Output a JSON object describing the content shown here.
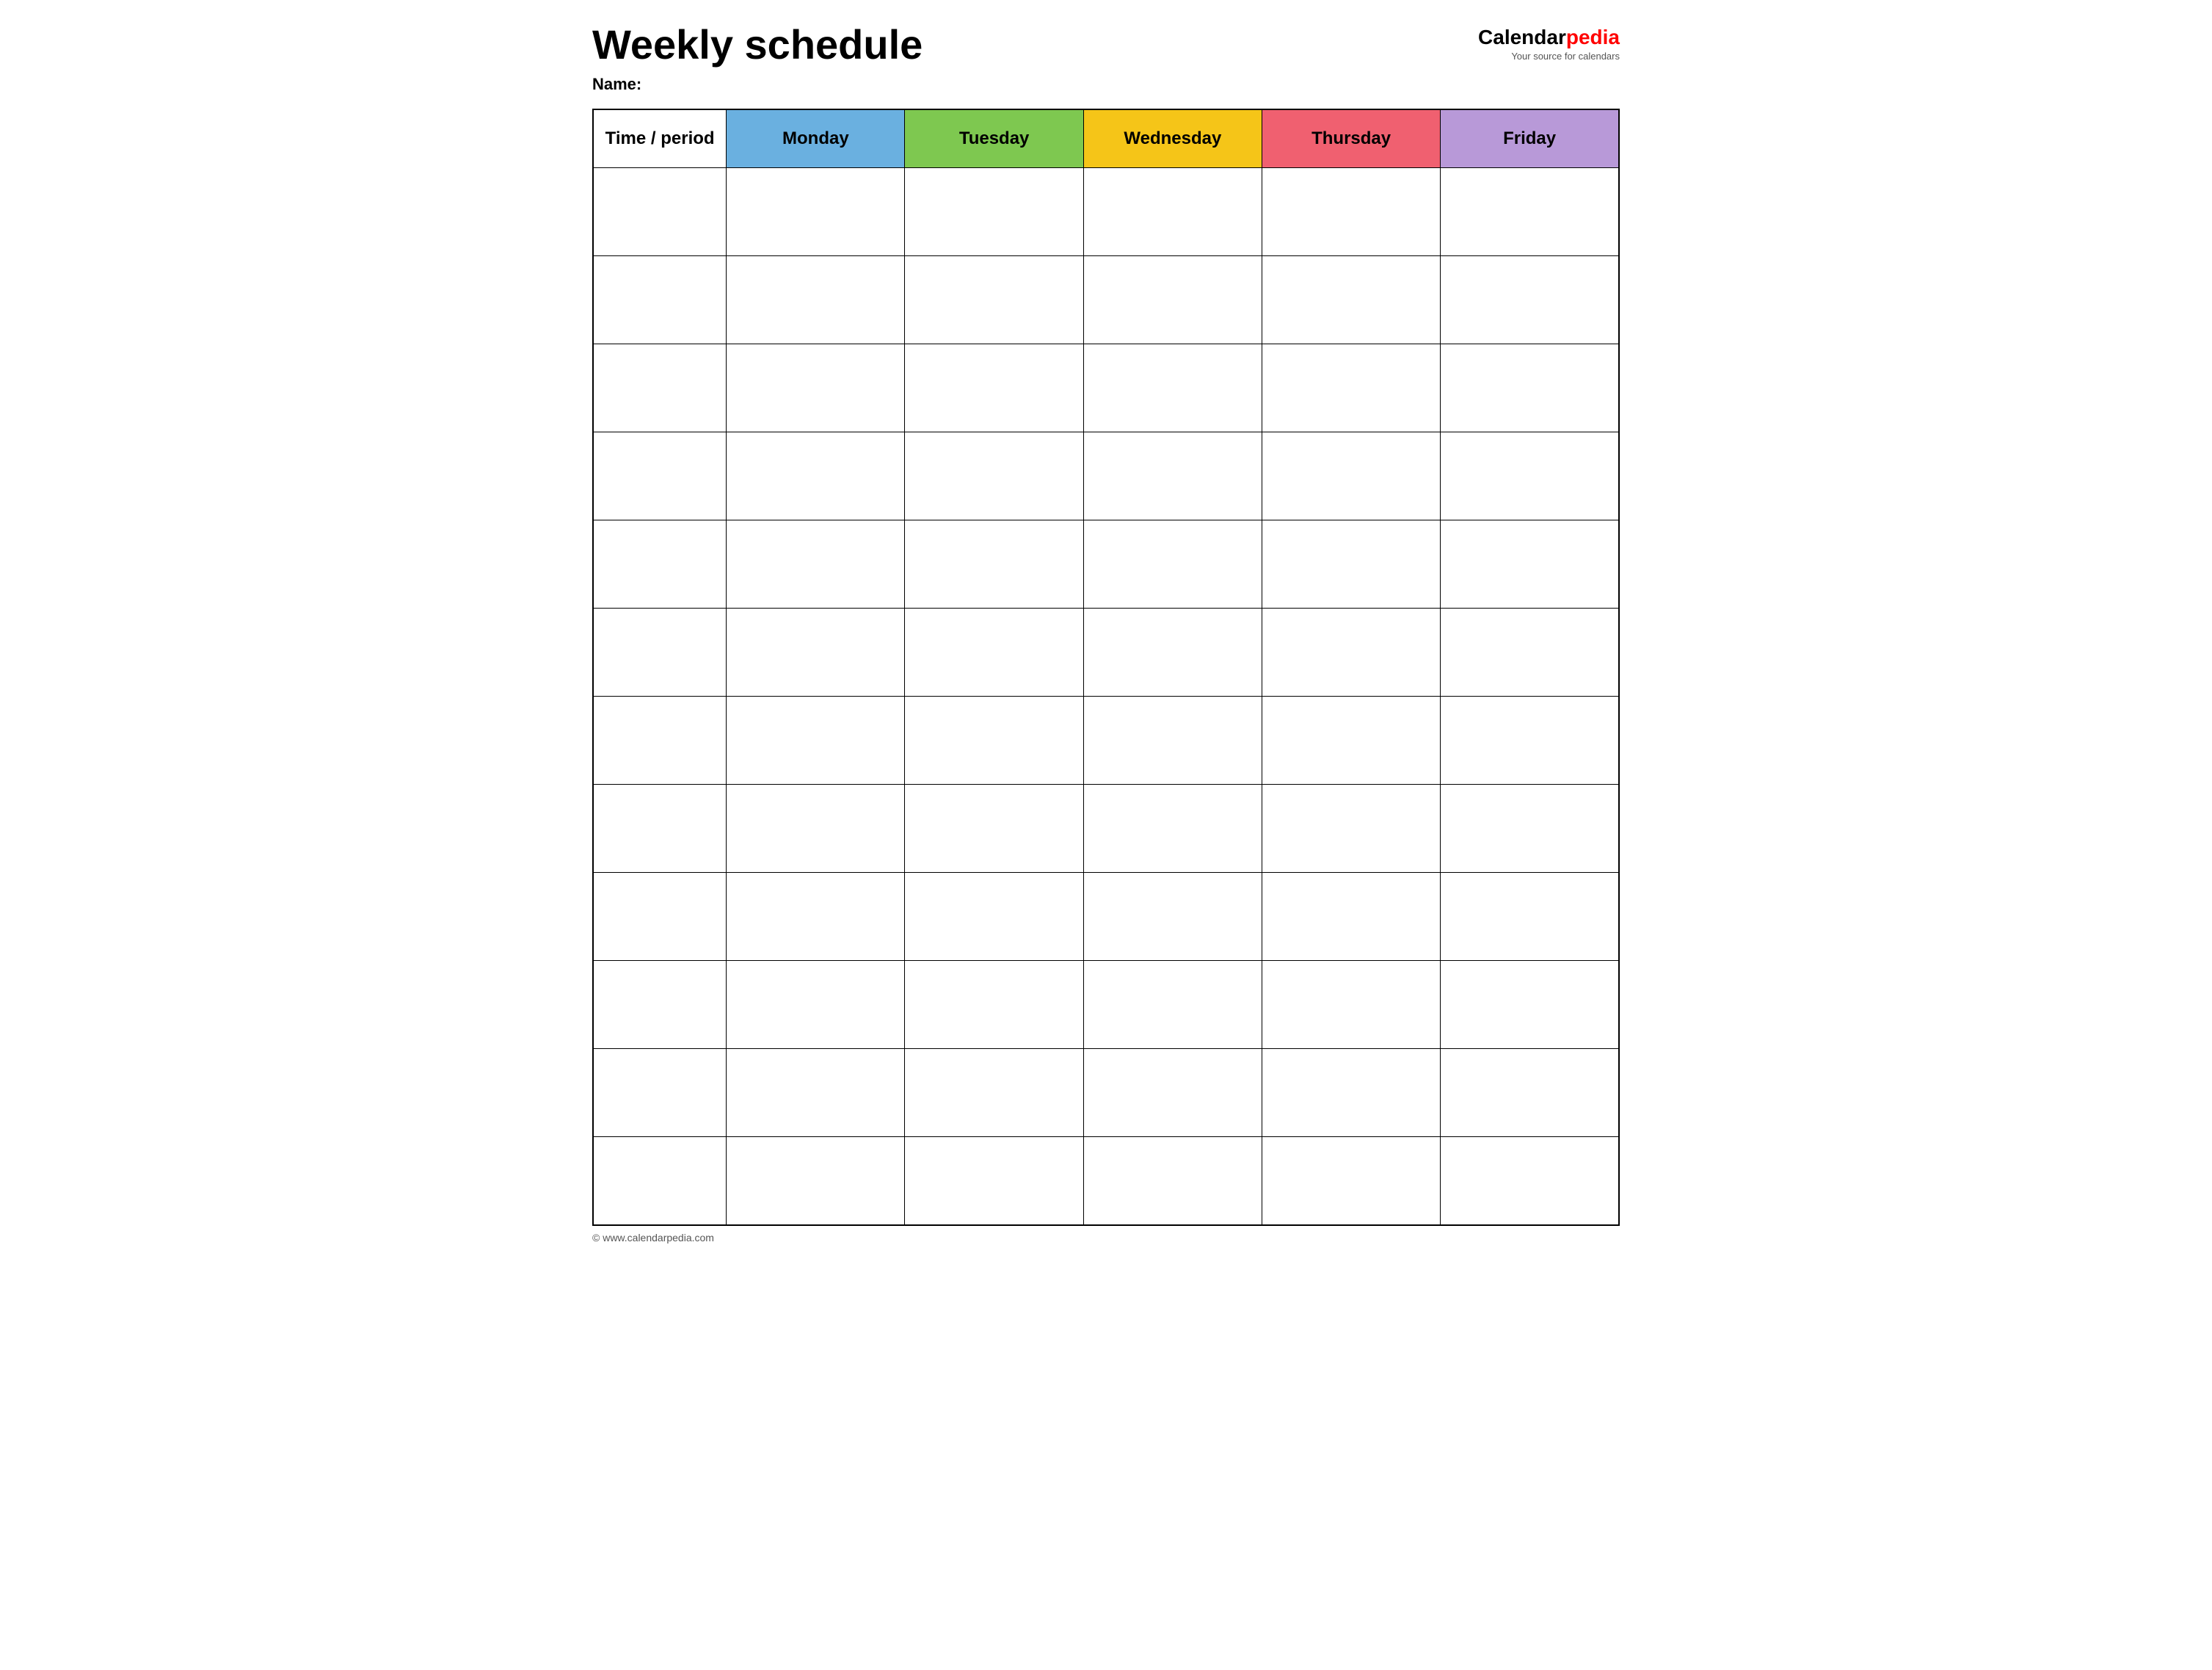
{
  "header": {
    "title": "Weekly schedule",
    "logo_calendar": "Calendar",
    "logo_pedia": "pedia",
    "logo_tagline": "Your source for calendars"
  },
  "name_label": "Name:",
  "columns": [
    {
      "id": "time",
      "label": "Time / period",
      "color": "#ffffff",
      "class": "col-time"
    },
    {
      "id": "monday",
      "label": "Monday",
      "color": "#6ab0e0",
      "class": "col-monday"
    },
    {
      "id": "tuesday",
      "label": "Tuesday",
      "color": "#7ec850",
      "class": "col-tuesday"
    },
    {
      "id": "wednesday",
      "label": "Wednesday",
      "color": "#f5c518",
      "class": "col-wednesday"
    },
    {
      "id": "thursday",
      "label": "Thursday",
      "color": "#f06070",
      "class": "col-thursday"
    },
    {
      "id": "friday",
      "label": "Friday",
      "color": "#b899d8",
      "class": "col-friday"
    }
  ],
  "rows": 12,
  "footer": {
    "url": "© www.calendarpedia.com"
  }
}
